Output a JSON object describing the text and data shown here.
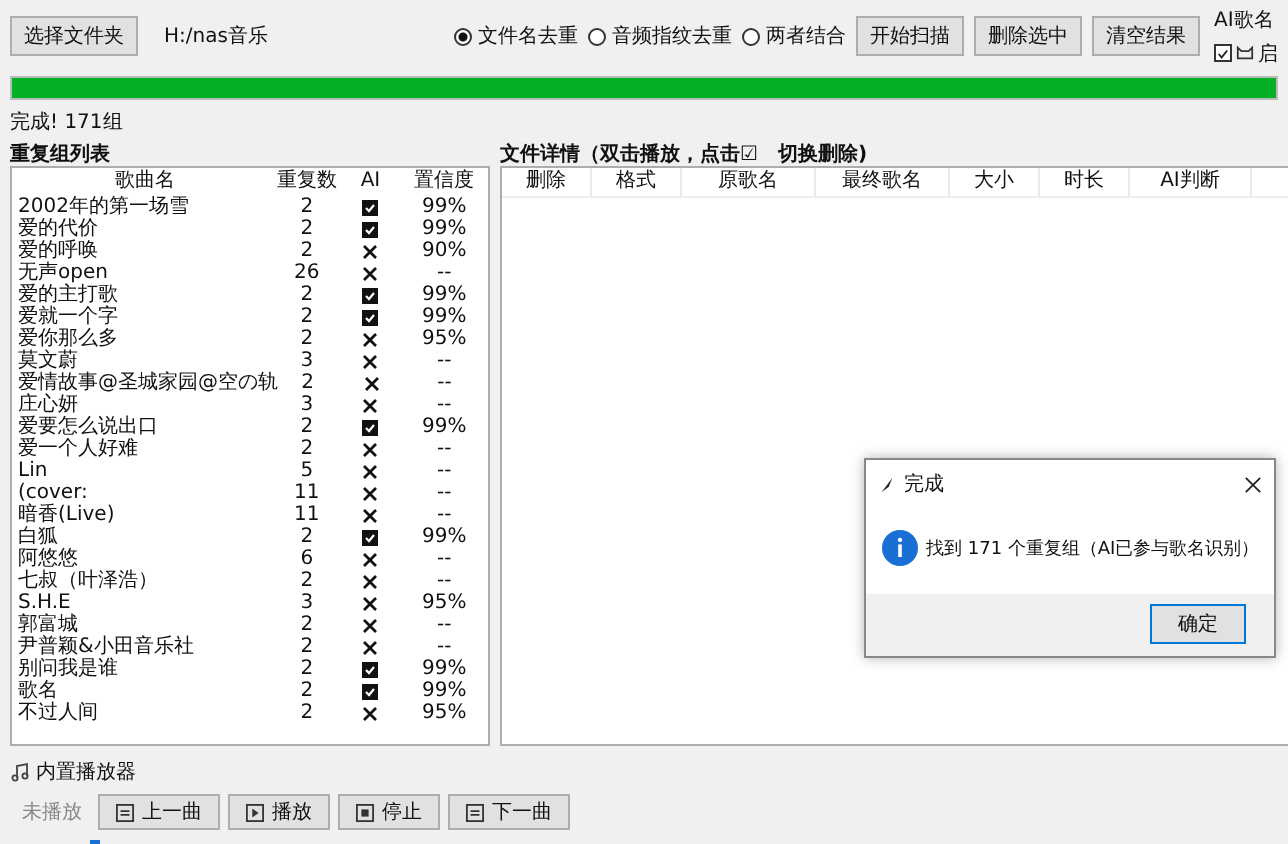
{
  "toolbar": {
    "select_button": "选择文件夹",
    "path": "H:/nas音乐",
    "modes": [
      {
        "label": "文件名去重",
        "selected": true
      },
      {
        "label": "音频指纹去重",
        "selected": false
      },
      {
        "label": "两者结合",
        "selected": false
      }
    ],
    "buttons": [
      "开始扫描",
      "删除选中",
      "清空结果"
    ],
    "ai": {
      "label": "AI歌名",
      "checked": true,
      "option": "启"
    }
  },
  "progress": {
    "level": 1
  },
  "status": "完成! 171组",
  "groups": {
    "title": "重复组列表",
    "columns": [
      "歌曲名",
      "重复数",
      "AI",
      "置信度"
    ],
    "rows": [
      {
        "name": "2002年的第一场雪",
        "count": "2",
        "ai": true,
        "confidence": "99%"
      },
      {
        "name": "爱的代价",
        "count": "2",
        "ai": true,
        "confidence": "99%"
      },
      {
        "name": "爱的呼唤",
        "count": "2",
        "ai": false,
        "confidence": "90%"
      },
      {
        "name": "无声open",
        "count": "26",
        "ai": false,
        "confidence": "--"
      },
      {
        "name": "爱的主打歌",
        "count": "2",
        "ai": true,
        "confidence": "99%"
      },
      {
        "name": "爱就一个字",
        "count": "2",
        "ai": true,
        "confidence": "99%"
      },
      {
        "name": "爱你那么多",
        "count": "2",
        "ai": false,
        "confidence": "95%"
      },
      {
        "name": "莫文蔚",
        "count": "3",
        "ai": false,
        "confidence": "--"
      },
      {
        "name": "爱情故事@圣城家园@空の轨",
        "count": "2",
        "ai": false,
        "confidence": "--"
      },
      {
        "name": "庄心妍",
        "count": "3",
        "ai": false,
        "confidence": "--"
      },
      {
        "name": "爱要怎么说出口",
        "count": "2",
        "ai": true,
        "confidence": "99%"
      },
      {
        "name": "爱一个人好难",
        "count": "2",
        "ai": false,
        "confidence": "--"
      },
      {
        "name": "Lin",
        "count": "5",
        "ai": false,
        "confidence": "--"
      },
      {
        "name": "(cover:",
        "count": "11",
        "ai": false,
        "confidence": "--"
      },
      {
        "name": "暗香(Live)",
        "count": "11",
        "ai": false,
        "confidence": "--"
      },
      {
        "name": "白狐",
        "count": "2",
        "ai": true,
        "confidence": "99%"
      },
      {
        "name": "阿悠悠",
        "count": "6",
        "ai": false,
        "confidence": "--"
      },
      {
        "name": "七叔（叶泽浩）",
        "count": "2",
        "ai": false,
        "confidence": "--"
      },
      {
        "name": "S.H.E",
        "count": "3",
        "ai": false,
        "confidence": "95%"
      },
      {
        "name": "郭富城",
        "count": "2",
        "ai": false,
        "confidence": "--"
      },
      {
        "name": "尹普颖&小田音乐社",
        "count": "2",
        "ai": false,
        "confidence": "--"
      },
      {
        "name": "别问我是谁",
        "count": "2",
        "ai": true,
        "confidence": "99%"
      },
      {
        "name": "歌名",
        "count": "2",
        "ai": true,
        "confidence": "99%"
      },
      {
        "name": "不过人间",
        "count": "2",
        "ai": false,
        "confidence": "95%"
      }
    ]
  },
  "details": {
    "title": "文件详情（双击播放，点击☑　切换删除)",
    "columns": [
      "删除",
      "格式",
      "原歌名",
      "最终歌名",
      "大小",
      "时长",
      "AI判断"
    ]
  },
  "player": {
    "title": "内置播放器",
    "state": "未播放",
    "buttons": [
      {
        "kind": "prev",
        "label": "上一曲"
      },
      {
        "kind": "play",
        "label": "播放"
      },
      {
        "kind": "stop",
        "label": "停止"
      },
      {
        "kind": "next",
        "label": "下一曲"
      }
    ]
  },
  "dialog": {
    "title": "完成",
    "message": "找到 171 个重复组（AI已参与歌名识别）",
    "button": "确定"
  }
}
